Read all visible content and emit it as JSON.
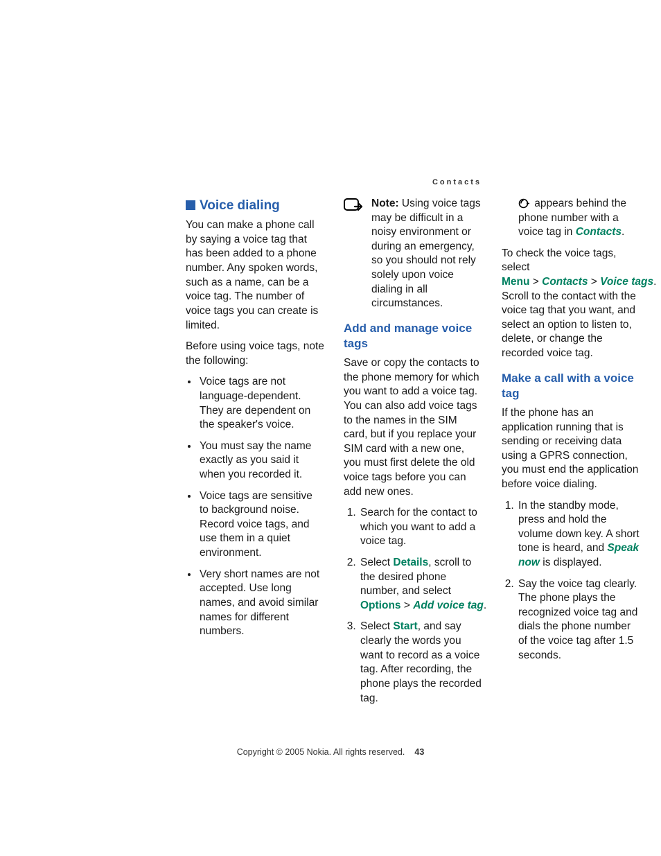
{
  "header": {
    "section": "Contacts"
  },
  "h1": "Voice dialing",
  "intro": "You can make a phone call by saying a voice tag that has been added to a phone number. Any spoken words, such as a name, can be a voice tag. The number of voice tags you can create is limited.",
  "before": "Before using voice tags, note the following:",
  "bullets": [
    "Voice tags are not language-dependent. They are dependent on the speaker's voice.",
    "You must say the name exactly as you said it when you recorded it.",
    "Voice tags are sensitive to background noise. Record voice tags, and use them in a quiet environment.",
    "Very short names are not accepted. Use long names, and avoid similar names for different numbers."
  ],
  "note_label": "Note:",
  "note_text": " Using voice tags may be difficult in a noisy environment or during an emergency, so you should not rely solely upon voice dialing in all circumstances.",
  "h2a": "Add and manage voice tags",
  "p_save": "Save or copy the contacts to the phone memory for which you want to add a voice tag. You can also add voice tags to the names in the SIM card, but if you replace your SIM card with a new one, you must first delete the old voice tags before you can add new ones.",
  "step1": "Search for the contact to which you want to add a voice tag.",
  "step2_a": "Select ",
  "details": "Details",
  "step2_b": ", scroll to the desired phone number, and select ",
  "options": "Options",
  "gt": " > ",
  "addvt": "Add voice tag",
  "period": ".",
  "step3_a": "Select ",
  "start": "Start",
  "step3_b": ", and say clearly the words you want to record as a voice tag. After recording, the phone plays the recorded tag.",
  "step3_c": " appears behind the phone number with a voice tag in ",
  "contacts_it": "Contacts",
  "check_a": "To check the voice tags, select ",
  "menu": "Menu",
  "contacts_it2": "Contacts",
  "voicetags_it": "Voice tags",
  "check_b": ". Scroll to the contact with the voice tag that you want, and select an option to listen to, delete, or change the recorded voice tag.",
  "h2b": "Make a call with a voice tag",
  "p_call": "If the phone has an application running that is sending or receiving data using a GPRS connection, you must end the application before voice dialing.",
  "cstep1_a": "In the standby mode, press and hold the volume down key. A short tone is heard, and ",
  "speaknow": "Speak now",
  "cstep1_b": " is displayed.",
  "cstep2": "Say the voice tag clearly. The phone plays the recognized voice tag and dials the phone number of the voice tag after 1.5 seconds.",
  "footer": {
    "copyright": "Copyright © 2005 Nokia. All rights reserved.",
    "page": "43"
  }
}
